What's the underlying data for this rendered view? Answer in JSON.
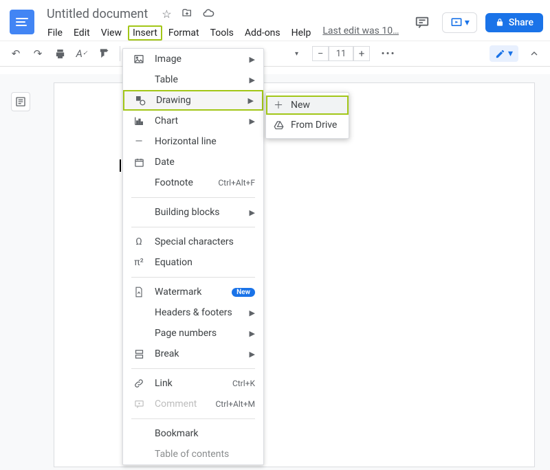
{
  "doc_title": "Untitled document",
  "menubar": {
    "file": "File",
    "edit": "Edit",
    "view": "View",
    "insert": "Insert",
    "format": "Format",
    "tools": "Tools",
    "addons": "Add-ons",
    "help": "Help"
  },
  "last_edit": "Last edit was 10…",
  "share": "Share",
  "font_size": "11",
  "insert_menu": {
    "image": "Image",
    "table": "Table",
    "drawing": "Drawing",
    "chart": "Chart",
    "hr": "Horizontal line",
    "date": "Date",
    "footnote": "Footnote",
    "footnote_sc": "Ctrl+Alt+F",
    "building_blocks": "Building blocks",
    "special": "Special characters",
    "equation": "Equation",
    "watermark": "Watermark",
    "watermark_badge": "New",
    "headers": "Headers & footers",
    "pagenum": "Page numbers",
    "break": "Break",
    "link": "Link",
    "link_sc": "Ctrl+K",
    "comment": "Comment",
    "comment_sc": "Ctrl+Alt+M",
    "bookmark": "Bookmark",
    "toc": "Table of contents"
  },
  "drawing_submenu": {
    "new": "New",
    "from_drive": "From Drive"
  }
}
